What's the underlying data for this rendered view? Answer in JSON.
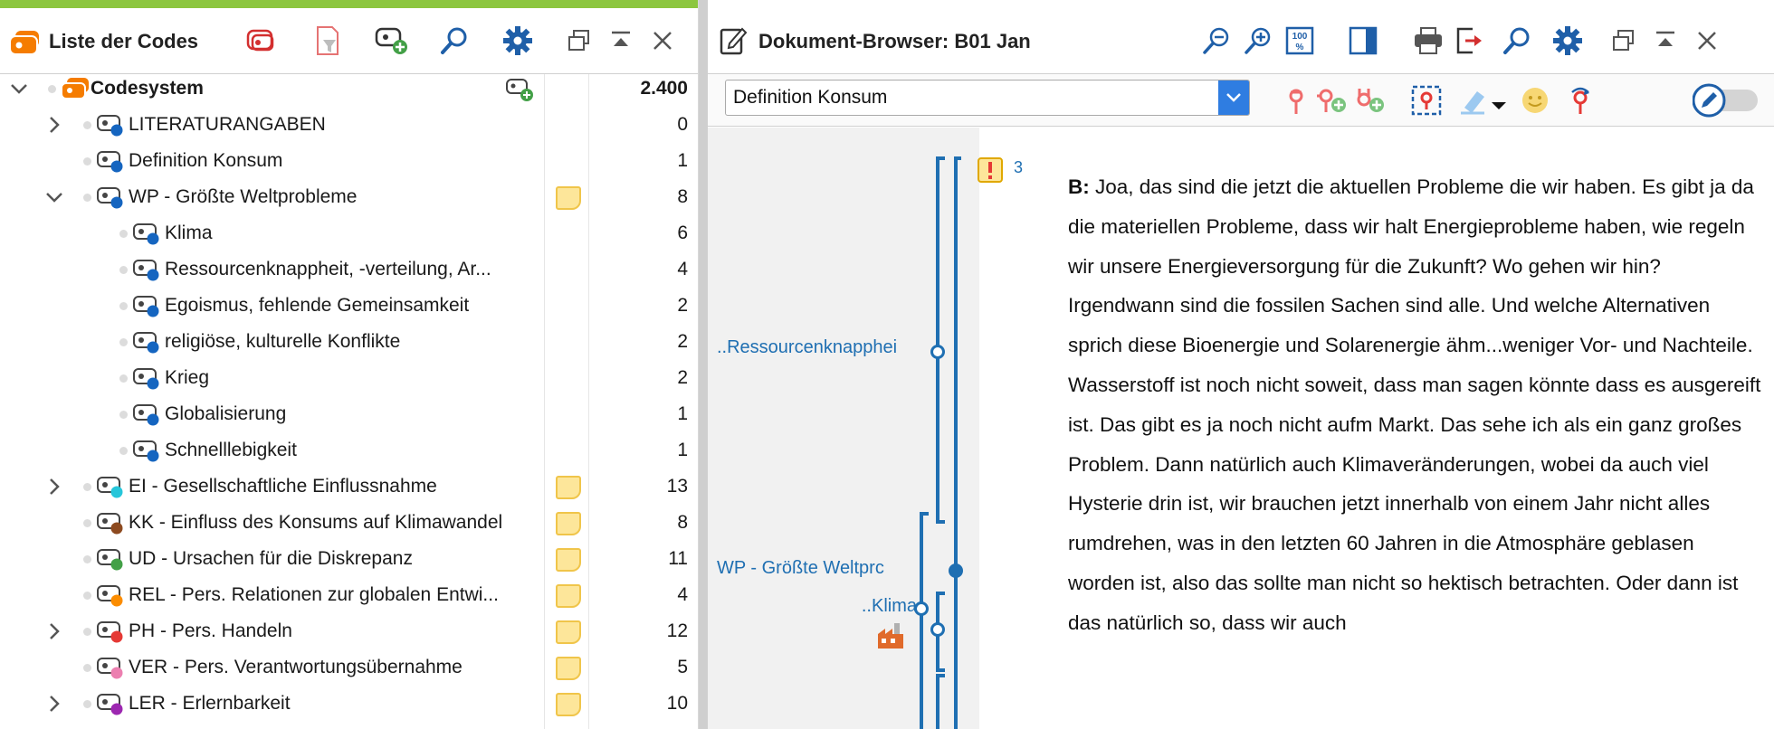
{
  "left_panel": {
    "title": "Liste der Codes",
    "toolbar_icons": [
      "code-system-icon",
      "filter-icon",
      "new-code-icon",
      "search-icon",
      "gear-icon",
      "undock-icon",
      "collapse-icon",
      "close-icon"
    ]
  },
  "code_tree": [
    {
      "label": "Codesystem",
      "count": "2.400",
      "level": 0,
      "expander": "expanded",
      "color": "#f57c00",
      "memo": false,
      "root": true
    },
    {
      "label": "LITERATURANGABEN",
      "count": "0",
      "level": 1,
      "expander": "collapsed",
      "color": "#1565c0",
      "memo": false
    },
    {
      "label": "Definition Konsum",
      "count": "1",
      "level": 1,
      "expander": "none",
      "color": "#1565c0",
      "memo": false
    },
    {
      "label": "WP - Größte Weltprobleme",
      "count": "8",
      "level": 1,
      "expander": "expanded",
      "color": "#1565c0",
      "memo": true
    },
    {
      "label": "Klima",
      "count": "6",
      "level": 2,
      "expander": "none",
      "color": "#1565c0",
      "memo": false
    },
    {
      "label": "Ressourcenknappheit, -verteilung, Ar...",
      "count": "4",
      "level": 2,
      "expander": "none",
      "color": "#1565c0",
      "memo": false
    },
    {
      "label": "Egoismus, fehlende Gemeinsamkeit",
      "count": "2",
      "level": 2,
      "expander": "none",
      "color": "#1565c0",
      "memo": false
    },
    {
      "label": "religiöse, kulturelle Konflikte",
      "count": "2",
      "level": 2,
      "expander": "none",
      "color": "#1565c0",
      "memo": false
    },
    {
      "label": "Krieg",
      "count": "2",
      "level": 2,
      "expander": "none",
      "color": "#1565c0",
      "memo": false
    },
    {
      "label": "Globalisierung",
      "count": "1",
      "level": 2,
      "expander": "none",
      "color": "#1565c0",
      "memo": false
    },
    {
      "label": "Schnelllebigkeit",
      "count": "1",
      "level": 2,
      "expander": "none",
      "color": "#1565c0",
      "memo": false
    },
    {
      "label": "EI - Gesellschaftliche Einflussnahme",
      "count": "13",
      "level": 1,
      "expander": "collapsed",
      "color": "#26c6da",
      "memo": true
    },
    {
      "label": "KK - Einfluss des Konsums auf Klimawandel",
      "count": "8",
      "level": 1,
      "expander": "none",
      "color": "#8d4a1f",
      "memo": true
    },
    {
      "label": "UD - Ursachen für die Diskrepanz",
      "count": "11",
      "level": 1,
      "expander": "none",
      "color": "#43a047",
      "memo": true
    },
    {
      "label": "REL - Pers. Relationen zur globalen Entwi...",
      "count": "4",
      "level": 1,
      "expander": "none",
      "color": "#fb8c00",
      "memo": true
    },
    {
      "label": "PH - Pers. Handeln",
      "count": "12",
      "level": 1,
      "expander": "collapsed",
      "color": "#e53935",
      "memo": true
    },
    {
      "label": "VER - Pers. Verantwortungsübernahme",
      "count": "5",
      "level": 1,
      "expander": "none",
      "color": "#ec7fb0",
      "memo": true
    },
    {
      "label": "LER - Erlernbarkeit",
      "count": "10",
      "level": 1,
      "expander": "collapsed",
      "color": "#9c27b0",
      "memo": true
    }
  ],
  "right_panel": {
    "title": "Dokument-Browser: B01 Jan",
    "toolbar_icons": [
      "zoom-out-icon",
      "zoom-in-icon",
      "zoom-100-icon",
      "layout-icon",
      "print-icon",
      "export-icon",
      "search-icon",
      "gear-icon",
      "undock-icon",
      "collapse-icon",
      "close-icon"
    ],
    "selected_code": "Definition Konsum",
    "coding_icons": [
      "code-icon",
      "code-add-icon",
      "code-add-green-icon",
      "code-area-icon",
      "highlighter-icon",
      "emoticon-icon",
      "code-undo-icon",
      "edit-toggle-icon"
    ]
  },
  "code_margin": {
    "labels": [
      {
        "text": "..Ressourcenknapphei"
      },
      {
        "text": "WP - Größte Weltprc"
      },
      {
        "text": "..Klima"
      }
    ],
    "paragraph_number": "3"
  },
  "document": {
    "speaker": "B:",
    "text": "Joa, das sind die jetzt die aktuellen Probleme die wir haben. Es gibt ja da die materiellen Probleme, dass wir halt Energieprobleme haben, wie regeln wir unsere Energieversorgung für die Zukunft? Wo gehen wir hin? Irgendwann sind die fossilen Sachen sind alle. Und welche Alternativen sprich diese Bioenergie und Solarenergie ähm...weniger Vor- und Nachteile. Wasserstoff ist noch nicht soweit, dass man sagen könnte dass es ausgereift ist. Das gibt es ja noch nicht aufm Markt. Das sehe ich als ein ganz großes Problem. Dann natürlich auch Klimaveränderungen, wobei da auch viel Hysterie drin ist, wir brauchen jetzt innerhalb von einem Jahr nicht alles rumdrehen, was in den letzten 60 Jahren in die Atmosphäre geblasen worden ist, also das sollte man nicht so hektisch betrachten. Oder dann ist das natürlich so, dass wir auch"
  }
}
